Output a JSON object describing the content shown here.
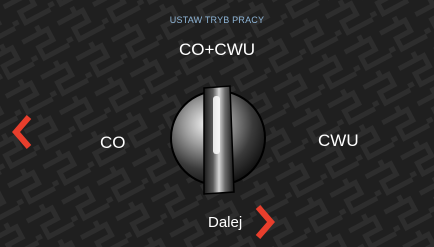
{
  "header": {
    "title": "USTAW TRYB PRACY",
    "current_mode": "CO+CWU"
  },
  "mode_selector": {
    "left_option": "CO",
    "right_option": "CWU",
    "knob_icon": "rotary-knob-icon"
  },
  "navigation": {
    "prev_icon": "chevron-left-icon",
    "next_label": "Dalej",
    "next_icon": "chevron-right-icon"
  },
  "colors": {
    "background": "#202020",
    "pattern_stroke": "#2c2c2c",
    "title": "#8fb6d8",
    "text": "#ffffff",
    "accent_arrow": "#e83e2c"
  }
}
